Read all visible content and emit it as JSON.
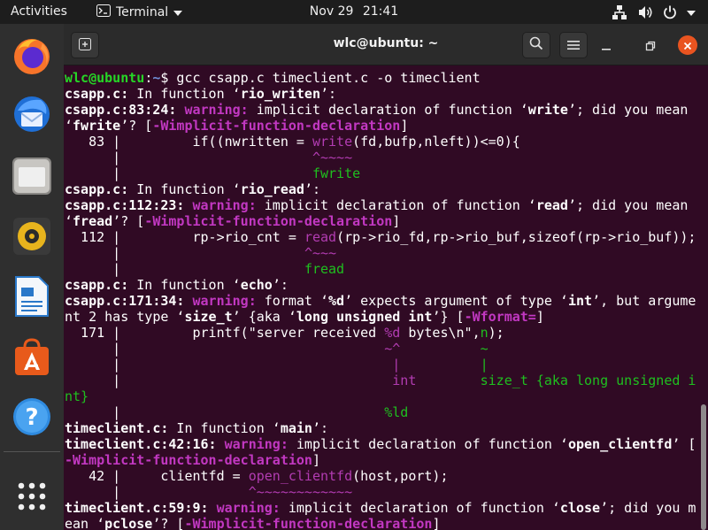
{
  "topbar": {
    "activities_label": "Activities",
    "app_label": "Terminal",
    "date": "Nov 29",
    "time": "21:41",
    "tray_icons": [
      "network-icon",
      "volume-icon",
      "power-icon"
    ]
  },
  "dock": {
    "items": [
      "firefox",
      "thunderbird",
      "files",
      "rhythmbox",
      "libreoffice-writer",
      "ubuntu-software",
      "help",
      "show-applications"
    ]
  },
  "window": {
    "title": "wlc@ubuntu: ~",
    "buttons": [
      "new-tab",
      "search",
      "menu",
      "minimize",
      "maximize",
      "close"
    ]
  },
  "terminal": {
    "lines": [
      [
        [
          "g",
          "wlc@ubuntu"
        ],
        [
          "w",
          ":"
        ],
        [
          "bl",
          "~"
        ],
        [
          "w",
          "$ gcc csapp.c timeclient.c -o timeclient"
        ]
      ],
      [
        [
          "b",
          "csapp.c:"
        ],
        [
          "w",
          " In function ‘"
        ],
        [
          "b",
          "rio_writen"
        ],
        [
          "w",
          "’:"
        ]
      ],
      [
        [
          "b",
          "csapp.c:83:24:"
        ],
        [
          "w",
          " "
        ],
        [
          "m",
          "warning:"
        ],
        [
          "w",
          " implicit declaration of function ‘"
        ],
        [
          "b",
          "write"
        ],
        [
          "w",
          "’; did you mean"
        ]
      ],
      [
        [
          "w",
          "‘"
        ],
        [
          "b",
          "fwrite"
        ],
        [
          "w",
          "’? ["
        ],
        [
          "m",
          "-Wimplicit-function-declaration"
        ],
        [
          "w",
          "]"
        ]
      ],
      [
        [
          "w",
          "   83 |         if((nwritten = "
        ],
        [
          "mr",
          "write"
        ],
        [
          "w",
          "(fd,bufp,nleft))<=0){"
        ]
      ],
      [
        [
          "w",
          "      |                        "
        ],
        [
          "mr",
          "^~~~~"
        ]
      ],
      [
        [
          "w",
          "      |                        "
        ],
        [
          "gr",
          "fwrite"
        ]
      ],
      [
        [
          "b",
          "csapp.c:"
        ],
        [
          "w",
          " In function ‘"
        ],
        [
          "b",
          "rio_read"
        ],
        [
          "w",
          "’:"
        ]
      ],
      [
        [
          "b",
          "csapp.c:112:23:"
        ],
        [
          "w",
          " "
        ],
        [
          "m",
          "warning:"
        ],
        [
          "w",
          " implicit declaration of function ‘"
        ],
        [
          "b",
          "read"
        ],
        [
          "w",
          "’; did you mean"
        ]
      ],
      [
        [
          "w",
          "‘"
        ],
        [
          "b",
          "fread"
        ],
        [
          "w",
          "’? ["
        ],
        [
          "m",
          "-Wimplicit-function-declaration"
        ],
        [
          "w",
          "]"
        ]
      ],
      [
        [
          "w",
          "  112 |         rp->rio_cnt = "
        ],
        [
          "mr",
          "read"
        ],
        [
          "w",
          "(rp->rio_fd,rp->rio_buf,sizeof(rp->rio_buf));"
        ]
      ],
      [
        [
          "w",
          "      |                       "
        ],
        [
          "mr",
          "^~~~"
        ]
      ],
      [
        [
          "w",
          "      |                       "
        ],
        [
          "gr",
          "fread"
        ]
      ],
      [
        [
          "b",
          "csapp.c:"
        ],
        [
          "w",
          " In function ‘"
        ],
        [
          "b",
          "echo"
        ],
        [
          "w",
          "’:"
        ]
      ],
      [
        [
          "b",
          "csapp.c:171:34:"
        ],
        [
          "w",
          " "
        ],
        [
          "m",
          "warning:"
        ],
        [
          "w",
          " format ‘"
        ],
        [
          "b",
          "%d"
        ],
        [
          "w",
          "’ expects argument of type ‘"
        ],
        [
          "b",
          "int"
        ],
        [
          "w",
          "’, but argume"
        ]
      ],
      [
        [
          "w",
          "nt 2 has type ‘"
        ],
        [
          "b",
          "size_t"
        ],
        [
          "w",
          "’ {aka ‘"
        ],
        [
          "b",
          "long unsigned int"
        ],
        [
          "w",
          "’} ["
        ],
        [
          "m",
          "-Wformat="
        ],
        [
          "w",
          "]"
        ]
      ],
      [
        [
          "w",
          "  171 |         printf(\"server received "
        ],
        [
          "mr",
          "%d"
        ],
        [
          "w",
          " bytes\\n\","
        ],
        [
          "gr",
          "n"
        ],
        [
          "w",
          ");"
        ]
      ],
      [
        [
          "w",
          "      |                                 "
        ],
        [
          "mr",
          "~^"
        ],
        [
          "w",
          "          "
        ],
        [
          "gr",
          "~"
        ]
      ],
      [
        [
          "w",
          "      |                                  "
        ],
        [
          "mr",
          "|"
        ],
        [
          "w",
          "          "
        ],
        [
          "gr",
          "|"
        ]
      ],
      [
        [
          "w",
          "      |                                  "
        ],
        [
          "mr",
          "int"
        ],
        [
          "w",
          "        "
        ],
        [
          "gr",
          "size_t {aka long unsigned i"
        ]
      ],
      [
        [
          "gr",
          "nt}"
        ]
      ],
      [
        [
          "w",
          "      |                                 "
        ],
        [
          "gr",
          "%ld"
        ]
      ],
      [
        [
          "b",
          "timeclient.c:"
        ],
        [
          "w",
          " In function ‘"
        ],
        [
          "b",
          "main"
        ],
        [
          "w",
          "’:"
        ]
      ],
      [
        [
          "b",
          "timeclient.c:42:16:"
        ],
        [
          "w",
          " "
        ],
        [
          "m",
          "warning:"
        ],
        [
          "w",
          " implicit declaration of function ‘"
        ],
        [
          "b",
          "open_clientfd"
        ],
        [
          "w",
          "’ ["
        ]
      ],
      [
        [
          "m",
          "-Wimplicit-function-declaration"
        ],
        [
          "w",
          "]"
        ]
      ],
      [
        [
          "w",
          "   42 |     clientfd = "
        ],
        [
          "mr",
          "open_clientfd"
        ],
        [
          "w",
          "(host,port);"
        ]
      ],
      [
        [
          "w",
          "      |                "
        ],
        [
          "mr",
          "^~~~~~~~~~~~~"
        ]
      ],
      [
        [
          "b",
          "timeclient.c:59:9:"
        ],
        [
          "w",
          " "
        ],
        [
          "m",
          "warning:"
        ],
        [
          "w",
          " implicit declaration of function ‘"
        ],
        [
          "b",
          "close"
        ],
        [
          "w",
          "’; did you m"
        ]
      ],
      [
        [
          "w",
          "ean ‘"
        ],
        [
          "b",
          "pclose"
        ],
        [
          "w",
          "’? ["
        ],
        [
          "m",
          "-Wimplicit-function-declaration"
        ],
        [
          "w",
          "]"
        ]
      ]
    ]
  }
}
